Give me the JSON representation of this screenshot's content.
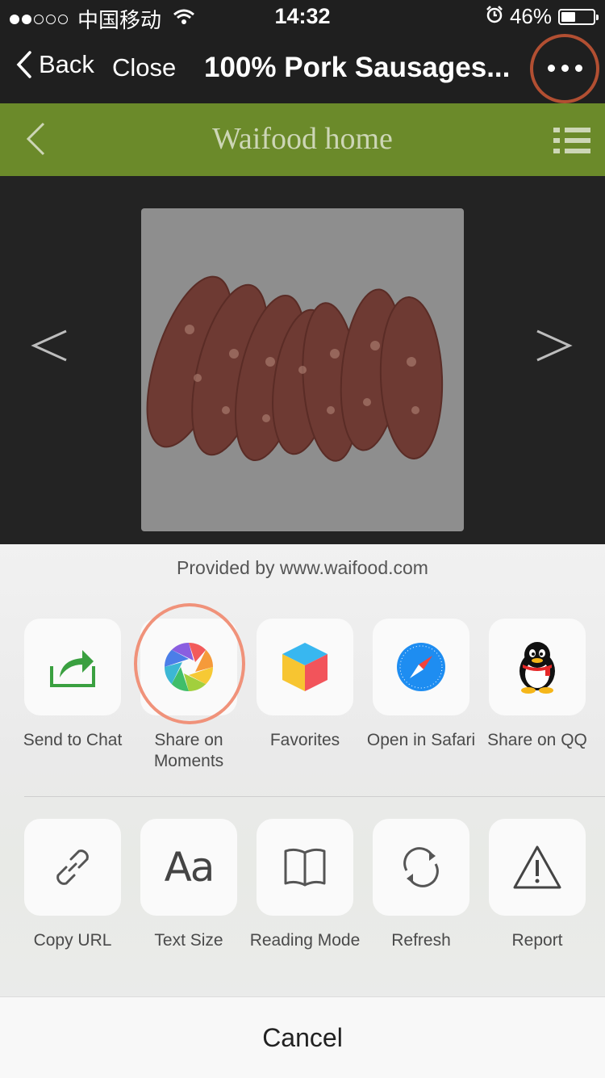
{
  "status_bar": {
    "carrier": "中国移动",
    "time": "14:32",
    "battery_percent": "46%",
    "battery_level": 0.46,
    "signal_icon": "signal-dots-icon",
    "wifi_icon": "wifi-icon",
    "alarm_icon": "alarm-icon"
  },
  "nav_bar": {
    "back_label": "Back",
    "close_label": "Close",
    "title": "100% Pork Sausages...",
    "more_icon": "more-dots-icon"
  },
  "site_header": {
    "title": "Waifood home",
    "back_icon": "chevron-left-icon",
    "menu_icon": "list-menu-icon",
    "color": "#6b8a2a"
  },
  "gallery": {
    "image": "pork-sausages-photo",
    "prev_icon": "chevron-left-icon",
    "next_icon": "chevron-right-icon"
  },
  "share_sheet": {
    "provided_by": "Provided by www.waifood.com",
    "share_items": [
      {
        "label": "Send to Chat",
        "icon": "send-to-chat-icon"
      },
      {
        "label": "Share on Moments",
        "icon": "moments-icon"
      },
      {
        "label": "Favorites",
        "icon": "favorites-cube-icon"
      },
      {
        "label": "Open in Safari",
        "icon": "safari-compass-icon"
      },
      {
        "label": "Share on QQ",
        "icon": "qq-penguin-icon"
      }
    ],
    "action_items": [
      {
        "label": "Copy URL",
        "icon": "link-icon"
      },
      {
        "label": "Text Size",
        "icon": "text-size-icon",
        "glyph": "Aa"
      },
      {
        "label": "Reading Mode",
        "icon": "book-icon"
      },
      {
        "label": "Refresh",
        "icon": "refresh-icon"
      },
      {
        "label": "Report",
        "icon": "warning-icon"
      }
    ],
    "cancel_label": "Cancel"
  },
  "colors": {
    "highlight_dark": "#b24f32",
    "highlight_light": "#f0927a"
  }
}
